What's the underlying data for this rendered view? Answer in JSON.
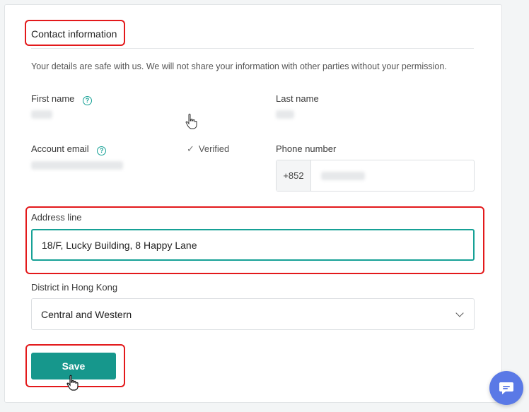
{
  "section": {
    "title": "Contact information",
    "note": "Your details are safe with us. We will not share your information with other parties without your permission."
  },
  "fields": {
    "first_name_label": "First name",
    "last_name_label": "Last name",
    "account_email_label": "Account email",
    "verified_text": "Verified",
    "phone_label": "Phone number",
    "phone_prefix": "+852",
    "address_label": "Address line",
    "address_value": "18/F, Lucky Building, 8 Happy Lane",
    "district_label": "District in Hong Kong",
    "district_value": "Central and Western"
  },
  "actions": {
    "save_label": "Save"
  },
  "icons": {
    "help": "question-circle-icon",
    "verified": "check-icon",
    "dropdown": "chevron-down-icon",
    "chat": "chat-bubble-icon"
  },
  "colors": {
    "accent": "#16978c",
    "highlight": "#e3191b",
    "chat": "#5a79e6"
  }
}
